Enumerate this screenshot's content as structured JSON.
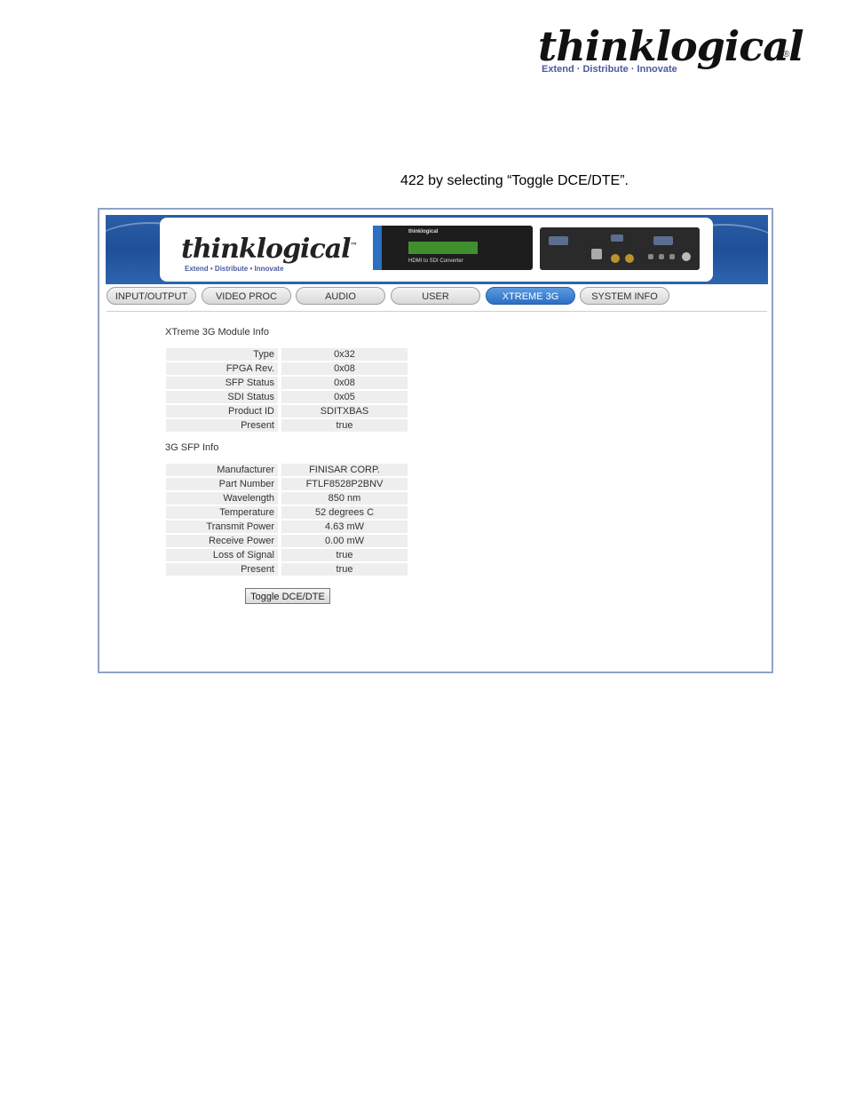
{
  "doc_header": {
    "logo_text": "thinklogical",
    "logo_reg": "®",
    "logo_tagline": "Extend · Distribute · Innovate"
  },
  "intro_text": "422 by selecting “Toggle DCE/DTE”.",
  "banner": {
    "logo_text": "thinklogical",
    "logo_tm": "™",
    "logo_tagline": "Extend • Distribute • Innovate",
    "device_brand": "thinklogical",
    "device_caption": "HDMI to SDI Converter"
  },
  "tabs": [
    {
      "label": "INPUT/OUTPUT",
      "active": false
    },
    {
      "label": "VIDEO PROC",
      "active": false
    },
    {
      "label": "AUDIO",
      "active": false
    },
    {
      "label": "USER",
      "active": false
    },
    {
      "label": "XTREME 3G",
      "active": true
    },
    {
      "label": "SYSTEM INFO",
      "active": false
    }
  ],
  "module_info": {
    "title": "XTreme 3G Module Info",
    "rows": [
      {
        "label": "Type",
        "value": "0x32"
      },
      {
        "label": "FPGA Rev.",
        "value": "0x08"
      },
      {
        "label": "SFP Status",
        "value": "0x08"
      },
      {
        "label": "SDI Status",
        "value": "0x05"
      },
      {
        "label": "Product ID",
        "value": "SDITXBAS"
      },
      {
        "label": "Present",
        "value": "true"
      }
    ]
  },
  "sfp_info": {
    "title": "3G SFP Info",
    "rows": [
      {
        "label": "Manufacturer",
        "value": "FINISAR CORP."
      },
      {
        "label": "Part Number",
        "value": "FTLF8528P2BNV"
      },
      {
        "label": "Wavelength",
        "value": "850 nm"
      },
      {
        "label": "Temperature",
        "value": "52 degrees C"
      },
      {
        "label": "Transmit Power",
        "value": "4.63 mW"
      },
      {
        "label": "Receive Power",
        "value": "0.00 mW"
      },
      {
        "label": "Loss of Signal",
        "value": "true"
      },
      {
        "label": "Present",
        "value": "true"
      }
    ]
  },
  "toggle_button_label": "Toggle DCE/DTE",
  "colors": {
    "active_tab": "#2c6fc4",
    "banner_blue": "#1f4f99",
    "table_row": "#eeeeee"
  }
}
